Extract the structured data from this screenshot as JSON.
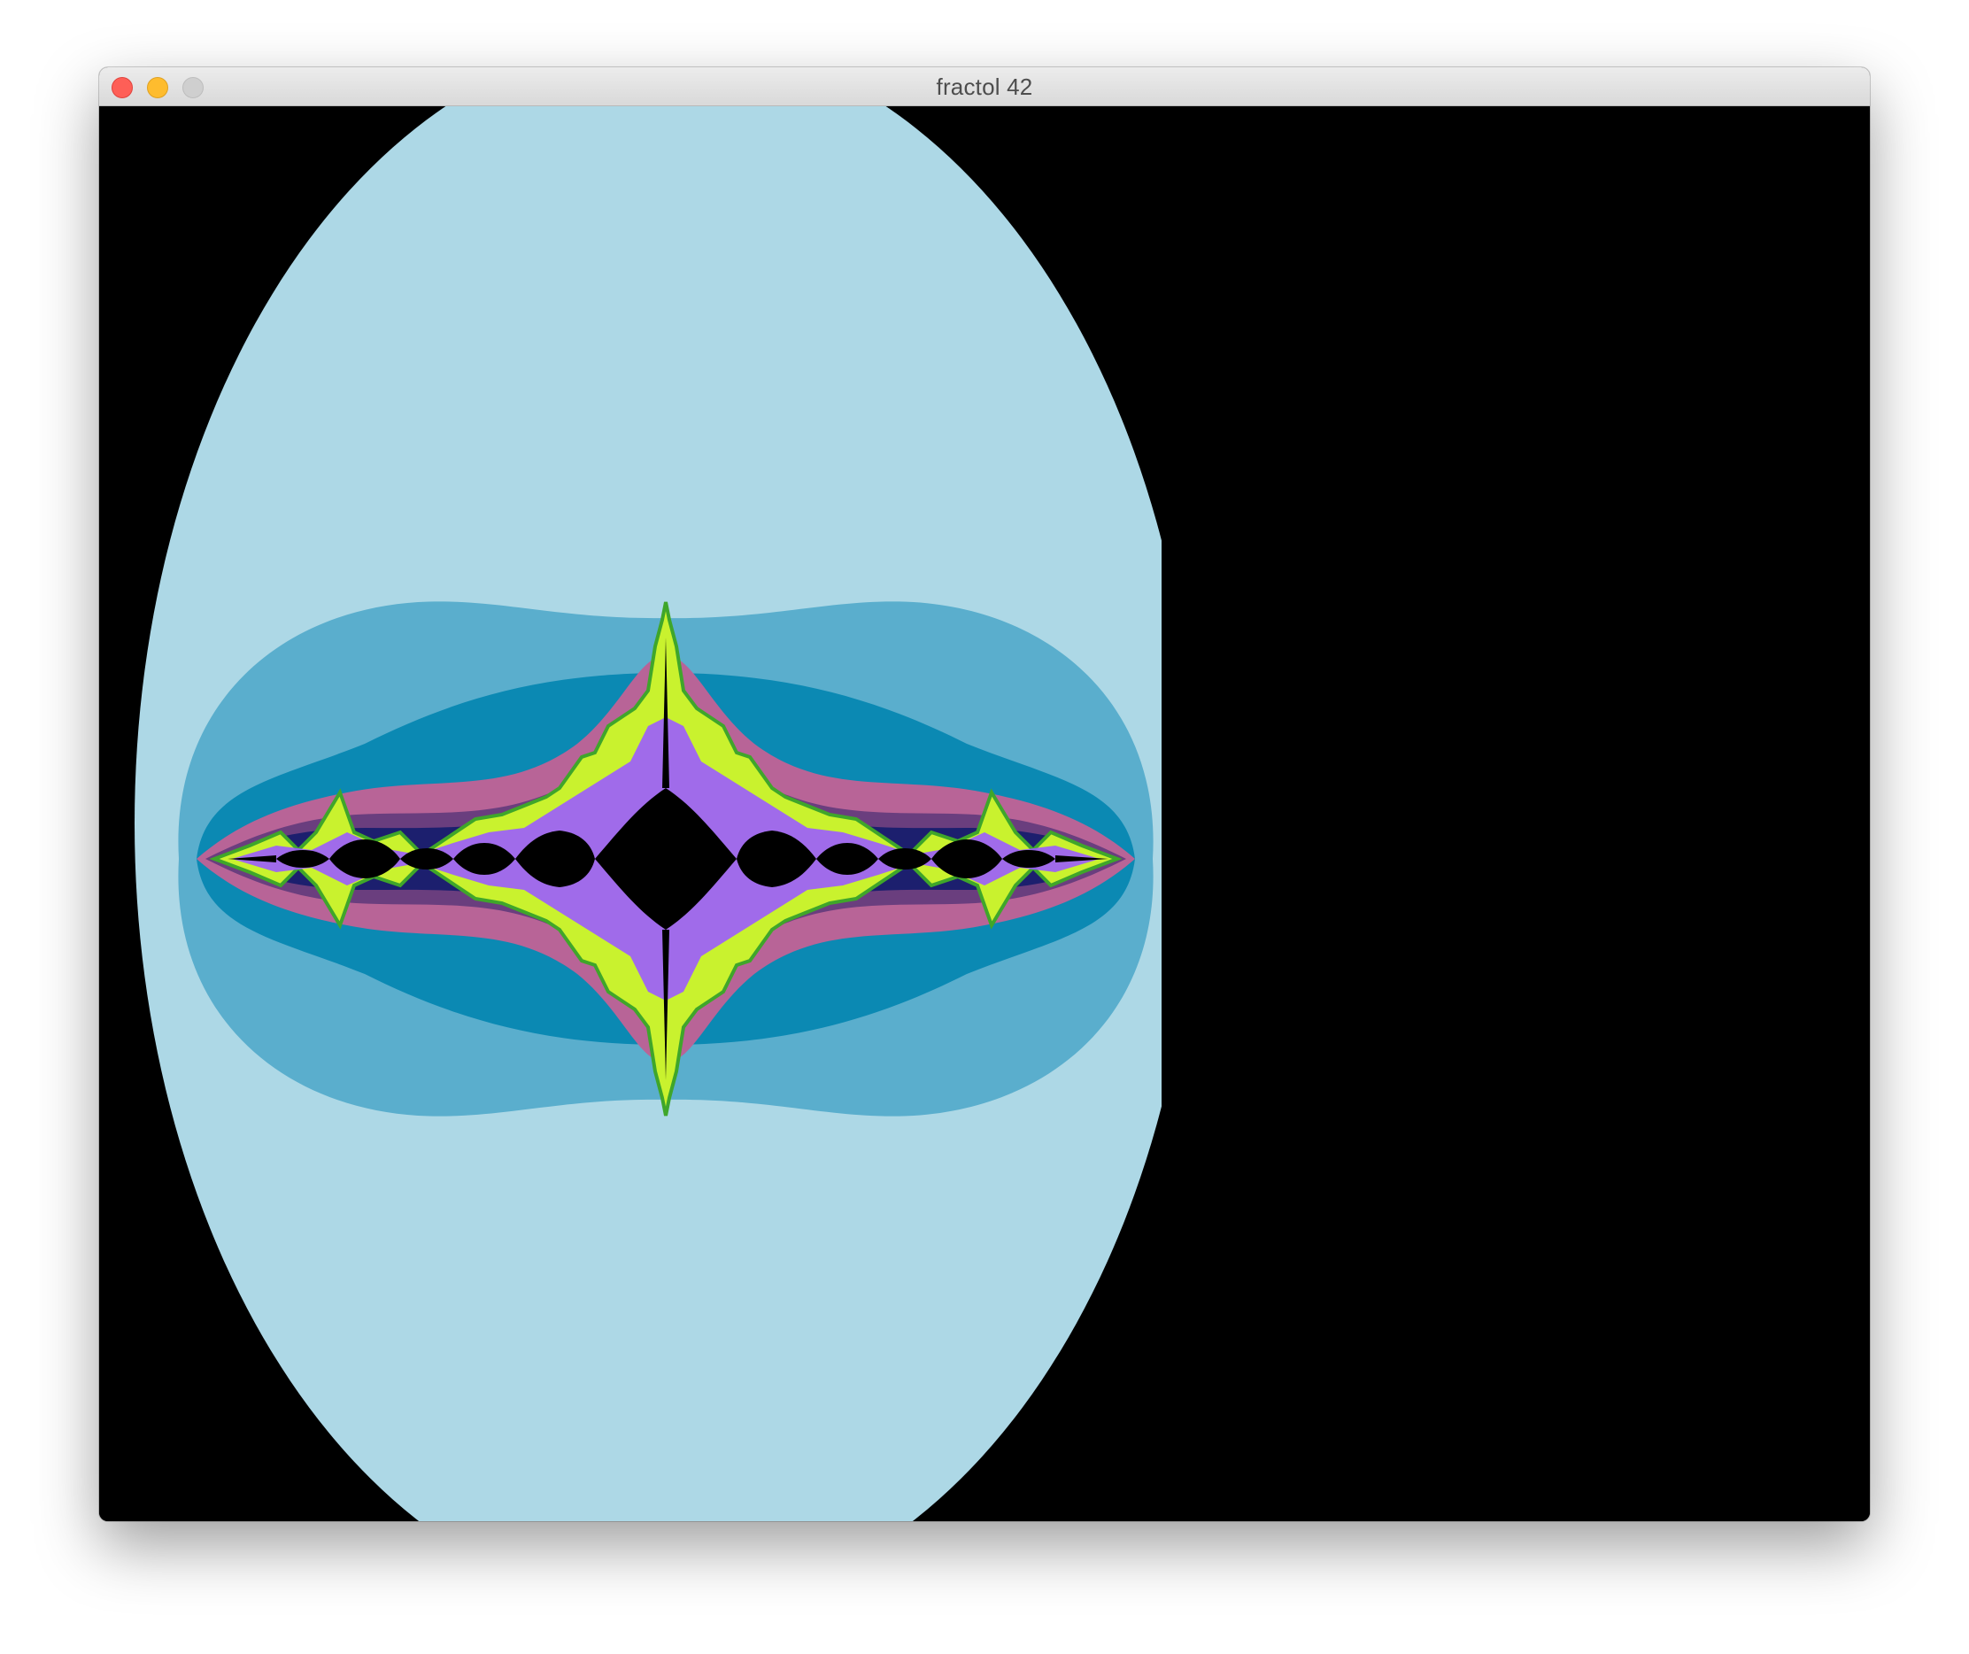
{
  "window": {
    "title": "fractol 42",
    "controls": [
      "close-button",
      "minimize-button",
      "zoom-button"
    ]
  },
  "render": {
    "fractal": "julia",
    "background_color": "#000000",
    "palette": {
      "outer_band": "#add8e6",
      "band_2": "#5aaecd",
      "band_3": "#0b89b3",
      "band_4_pink": "#b86497",
      "band_5_purple": "#6a3e7e",
      "band_6_navy": "#1c1f6e",
      "band_7_green": "#3fa62a",
      "band_8_lime": "#c9f22e",
      "band_9_violet": "#9b5cff",
      "set_interior": "#000000"
    }
  }
}
